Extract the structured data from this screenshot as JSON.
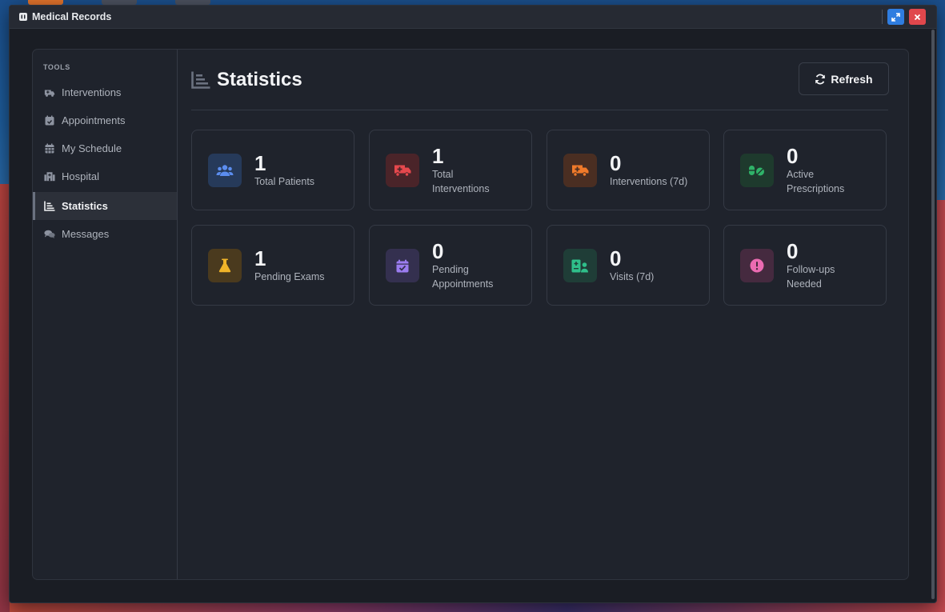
{
  "window": {
    "title": "Medical Records"
  },
  "sidebar": {
    "heading": "TOOLS",
    "items": [
      {
        "label": "Interventions",
        "icon": "ambulance-icon"
      },
      {
        "label": "Appointments",
        "icon": "calendar-check-icon"
      },
      {
        "label": "My Schedule",
        "icon": "calendar-grid-icon"
      },
      {
        "label": "Hospital",
        "icon": "hospital-icon"
      },
      {
        "label": "Statistics",
        "icon": "chart-icon",
        "active": true
      },
      {
        "label": "Messages",
        "icon": "comments-icon"
      }
    ]
  },
  "main": {
    "title": "Statistics",
    "refresh_label": "Refresh"
  },
  "stats": [
    {
      "value": "1",
      "label": "Total Patients",
      "icon": "users-icon",
      "color": "#5b8def"
    },
    {
      "value": "1",
      "label": "Total Interventions",
      "icon": "ambulance-icon",
      "color": "#e5484d"
    },
    {
      "value": "0",
      "label": "Interventions (7d)",
      "icon": "ambulance-icon",
      "color": "#f07a2a"
    },
    {
      "value": "0",
      "label": "Active Prescriptions",
      "icon": "pills-icon",
      "color": "#2fb369"
    },
    {
      "value": "1",
      "label": "Pending Exams",
      "icon": "flask-icon",
      "color": "#f0b429"
    },
    {
      "value": "0",
      "label": "Pending Appointments",
      "icon": "calendar-check-icon",
      "color": "#9b7cf0"
    },
    {
      "value": "0",
      "label": "Visits (7d)",
      "icon": "patient-card-icon",
      "color": "#2fbf8a"
    },
    {
      "value": "0",
      "label": "Follow-ups Needed",
      "icon": "alert-circle-icon",
      "color": "#ec6bb2"
    }
  ]
}
